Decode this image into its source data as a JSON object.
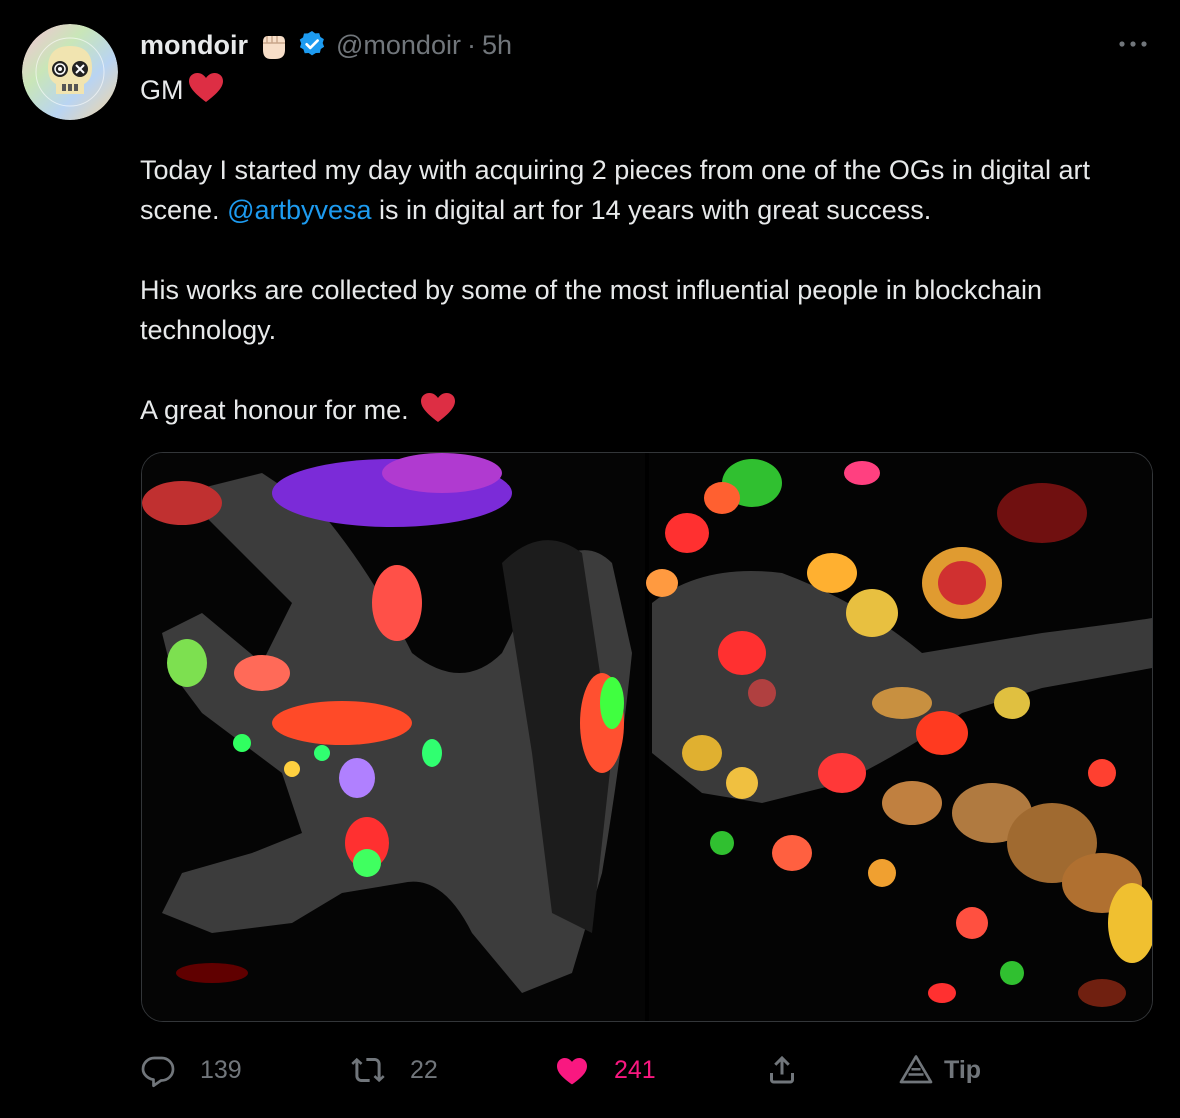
{
  "author": {
    "name": "mondoir",
    "handle": "@mondoir",
    "separator": "·",
    "time": "5h",
    "avatar_icon": "nft-skull-avatar"
  },
  "text": {
    "line1": "GM",
    "para1_a": "Today I started my day with acquiring 2 pieces from one of the OGs in digital art scene. ",
    "mention": "@artbyvesa",
    "para1_b": " is in digital art for 14 years with great success.",
    "para2": "His works are collected by some of the most influential people in blockchain technology.",
    "para3": "A great honour for me. "
  },
  "actions": {
    "reply_count": "139",
    "retweet_count": "22",
    "like_count": "241",
    "tip_label": "Tip"
  },
  "colors": {
    "accent": "#1d9bf0",
    "like": "#f91880",
    "muted": "#71767b",
    "heart": "#dd2e44"
  }
}
